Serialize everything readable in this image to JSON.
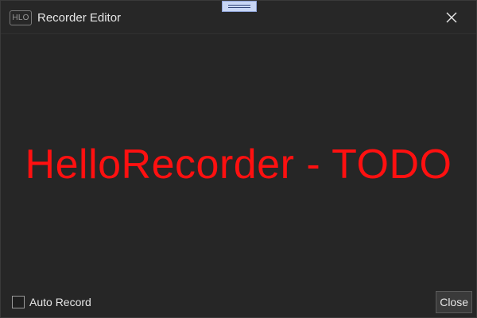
{
  "window": {
    "app_icon_text": "HLO",
    "title": "Recorder Editor",
    "close_icon": "close-icon",
    "drag_handle_icon": "drag-handle-icon"
  },
  "main": {
    "message": "HelloRecorder - TODO",
    "message_color": "#ff1010"
  },
  "footer": {
    "auto_record": {
      "label": "Auto Record",
      "checked": false
    },
    "close_button_label": "Close"
  },
  "colors": {
    "background": "#262626",
    "text": "#e6e6e6"
  }
}
